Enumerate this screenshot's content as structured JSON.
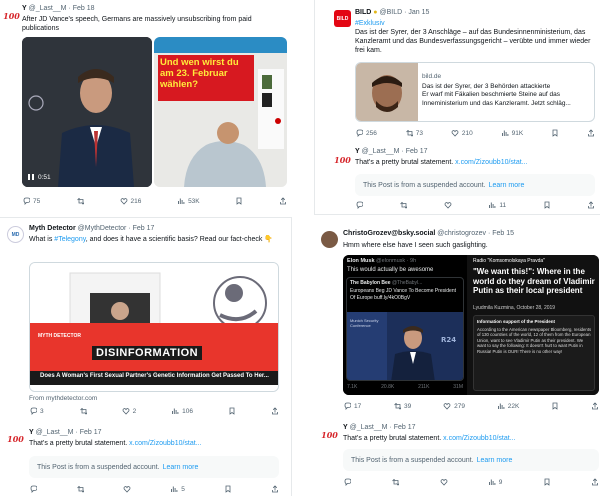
{
  "tl": {
    "main": {
      "name": "Y",
      "handle": "@_Last__M",
      "date": "Feb 18",
      "text": "After JD Vance's speech, Germans are massively unsubscribing from paid publications",
      "video_time": "0:51",
      "magazine_headline": "Und wen wirst du am 23. Februar wählen?",
      "metrics": {
        "replies": "75",
        "retweets": "216",
        "likes": "53K"
      }
    }
  },
  "tr": {
    "main": {
      "name": "BILD",
      "handle": "@BILD",
      "date": "Jan 15",
      "avatar": "BILD",
      "hashtag": "#Exklusiv",
      "text": "Das ist der Syrer, der 3 Anschläge – auf das Bundesinnenministerium, das Kanzleramt und das Bundesverfassungsgericht – verübte und immer wieder frei kam.",
      "card_domain": "bild.de",
      "card_title": "Das ist der Syrer, der 3 Behörden attackierte",
      "card_desc": "Er warf mit Fäkalien beschmierte Steine auf das Inneministerium und das Kanzleramt. Jetzt schläg...",
      "metrics": {
        "replies": "256",
        "retweets": "73",
        "likes": "210",
        "views": "91K"
      }
    },
    "reply": {
      "name": "Y",
      "handle": "@_Last__M",
      "date": "Feb 17",
      "text": "That's a pretty brutal statement.",
      "link": "x.com/Zizoubb10/stat...",
      "suspended": "This Post is from a suspended account.",
      "learn_more": "Learn more",
      "metrics": {
        "likes": "11"
      }
    }
  },
  "bl": {
    "main": {
      "name": "Myth Detector",
      "handle": "@MythDetector",
      "date": "Feb 17",
      "text_a": "What is ",
      "hashtag": "#Telegony",
      "text_b": ", and does it have a scientific basis? Read our fact-check",
      "emoji": "👇",
      "banner_logo": "MYTH DETECTOR",
      "banner_label": "DISINFORMATION",
      "banner_caption": "Does A Woman's First Sexual Partner's Genetic Information Get Passed To Her...",
      "source": "From mythdetector.com",
      "metrics": {
        "replies": "3",
        "likes": "2",
        "views": "106"
      }
    },
    "reply": {
      "name": "Y",
      "handle": "@_Last__M",
      "date": "Feb 17",
      "text": "That's a pretty brutal statement.",
      "link": "x.com/Zizoubb10/stat...",
      "suspended": "This Post is from a suspended account.",
      "learn_more": "Learn more",
      "metrics": {
        "likes": "5"
      }
    }
  },
  "br": {
    "main": {
      "name": "ChristoGrozev@bsky.social",
      "handle": "@christogrozev",
      "date": "Feb 15",
      "text": "Hmm where else have I seen such gaslighting.",
      "quote_user": "Elon Musk",
      "quote_handle": "@elonmusk · 9h",
      "quote_text": "This would actually be awesome",
      "inner_user": "The Babylon Bee",
      "inner_handle": "@TheBabyl...",
      "inner_text": "Europeans Beg JD Vance To Become President Of Europe buff.ly/4kO0BgV",
      "inner_stage": "Munich Security Conference",
      "inner_metrics": {
        "replies": "7.1K",
        "retweets": "20.8K",
        "likes": "211K",
        "views": "31M"
      },
      "right_channel": "Radio \"Komsomolskaya Pravda\"",
      "right_headline": "\"We want this!\": Where in the world do they dream of Vladimir Putin as their local president",
      "right_byline": "Lyudmila Kuzmina, October 28, 2019",
      "right_card_title": "Information support of the President",
      "right_card_text": "According to the American newspaper Bloomberg, residents of 130 countries of the world, 12 of them from the European Union, want to see Vladimir Putin as their president. We want to say the following: It doesn't hurt to want Putin in Russia! Putin is OUR! There is no other way!",
      "metrics": {
        "replies": "17",
        "retweets": "39",
        "likes": "279",
        "views": "22K"
      }
    },
    "reply": {
      "name": "Y",
      "handle": "@_Last__M",
      "date": "Feb 17",
      "text": "That's a pretty brutal statement.",
      "link": "x.com/Zizoubb10/stat...",
      "suspended": "This Post is from a suspended account.",
      "learn_more": "Learn more",
      "metrics": {
        "likes": "9"
      }
    }
  },
  "icons": [
    "reply-icon",
    "retweet-icon",
    "like-icon",
    "views-icon",
    "bookmark-icon",
    "share-icon"
  ],
  "colors": {
    "link": "#1d9bf0",
    "muted": "#536471",
    "suspended_bg": "#f7f9f9",
    "bild_red": "#e30613",
    "myth_red": "#e8352c"
  }
}
